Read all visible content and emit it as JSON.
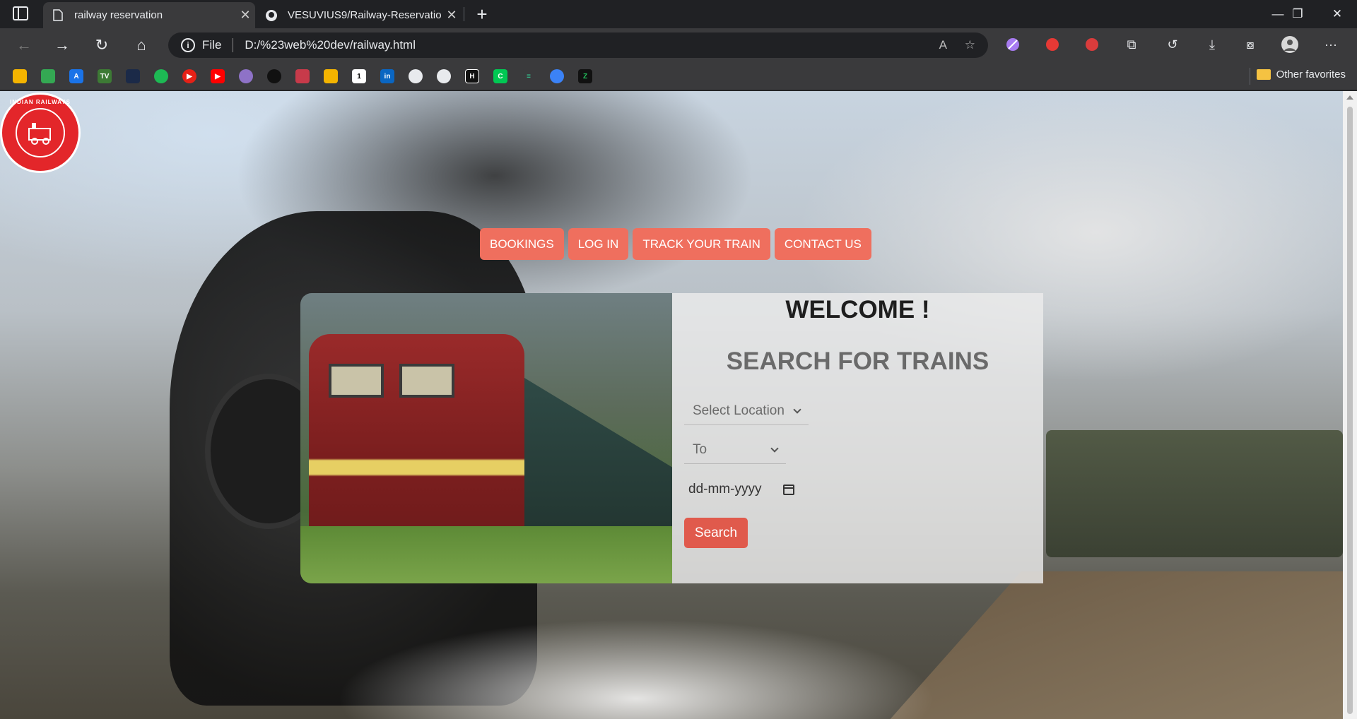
{
  "browser": {
    "tabs": [
      {
        "title": "railway reservation",
        "icon": "document-icon",
        "active": true
      },
      {
        "title": "VESUVIUS9/Railway-Reservation",
        "icon": "github-icon",
        "active": false
      }
    ],
    "address": {
      "scheme_label": "File",
      "url": "D:/%23web%20dev/railway.html"
    },
    "bookmarks_other": "Other favorites",
    "window_controls": [
      "minimize",
      "restore",
      "close"
    ]
  },
  "page": {
    "nav": {
      "bookings": "BOOKINGS",
      "login": "LOG IN",
      "track": "TRACK YOUR TRAIN",
      "contact": "CONTACT US"
    },
    "card": {
      "welcome": "WELCOME !",
      "heading": "SEARCH FOR TRAINS",
      "from_select": "Select Location",
      "to_select": "To",
      "date_placeholder": "dd-mm-yyyy",
      "search_button": "Search"
    },
    "logo": {
      "ring_text": "INDIAN RAILWAYS"
    }
  },
  "colors": {
    "nav_button": "#ef6f5e",
    "search_button": "#e05a4c",
    "logo_red": "#e3262a"
  }
}
